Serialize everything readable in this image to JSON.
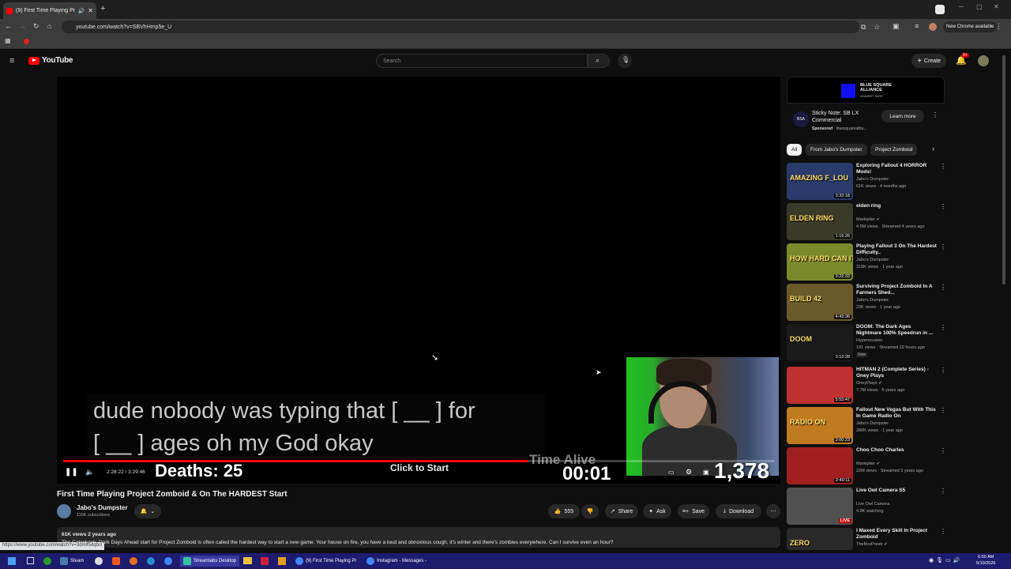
{
  "browser": {
    "tab_title": "(9) First Time Playing Proj",
    "new_tab_label": "+",
    "url": "youtube.com/watch?v=SBVhHmp5e_U",
    "new_chrome_label": "New Chrome available",
    "status_url": "https://www.youtube.com/watch?v=3dmlf5dqbcl"
  },
  "masthead": {
    "logo_text": "YouTube",
    "search_placeholder": "Search",
    "create_label": "Create",
    "notif_count": "9+"
  },
  "player": {
    "caption_line1": "dude nobody was typing that [ __ ] for",
    "caption_line2": "[ __ ] ages oh my God okay",
    "time_current": "2:28:22",
    "time_total": "3:29:46",
    "time_separator": " / ",
    "progress_fraction": 0.653,
    "overlay_deaths_label": "Deaths:",
    "overlay_deaths_value": "25",
    "overlay_click_to_start": "Click to Start",
    "overlay_time_alive_label": "Time Alive",
    "overlay_time_alive_value": "00:01",
    "overlay_score": "1,378"
  },
  "video": {
    "title": "First Time Playing Project Zomboid & On The HARDEST Start",
    "channel_name": "Jabo's Dumpster",
    "subscribers": "116K subscribers",
    "like_count": "555",
    "share_label": "Share",
    "ask_label": "Ask",
    "save_label": "Save",
    "download_label": "Download",
    "desc_meta": "61K views  2 years ago",
    "desc_text": "The Cataclysm: Dark Days Ahead start for Project Zomboid is often called the hardest way to start a new game. Your house on fire, you have a loud and obnoxious cough, it's winter and there's zombies everywhere. Can I survive even an hour?"
  },
  "ad": {
    "brand_title": "BLUE SQUARE ALLIANCE",
    "brand_sub": "AGAINST HATE",
    "title": "Sticky Note: SB LX Commercial",
    "sponsored": "Sponsored",
    "advertiser": "bluesquarealllia...",
    "learn_more": "Learn more",
    "logo_text": "BSA"
  },
  "chips": [
    "All",
    "From Jabo's Dumpster",
    "Project Zomboid"
  ],
  "recommendations": [
    {
      "title": "Exploring Fallout 4 HORROR Mods!",
      "channel": "Jabo's Dumpster",
      "meta": "61K views · 4 months ago",
      "duration": "3:33:18",
      "thumb_text": "AMAZING F_LOU",
      "thumb_color": "#2a3a6a",
      "verified": false
    },
    {
      "title": "elden ring",
      "channel": "Markiplier",
      "meta": "4.5M views · Streamed 4 years ago",
      "duration": "1:15:26",
      "thumb_text": "ELDEN RING",
      "thumb_color": "#3a3a2a",
      "verified": true
    },
    {
      "title": "Playing Fallout 3 On The Hardest Difficulty..",
      "channel": "Jabo's Dumpster",
      "meta": "318K views · 1 year ago",
      "duration": "3:22:33",
      "thumb_text": "HOW HARD CAN IT BE?",
      "thumb_color": "#7a8a2a",
      "verified": false
    },
    {
      "title": "Surviving Project Zomboid In A Farmers Shed...",
      "channel": "Jabo's Dumpster",
      "meta": "23K views · 1 year ago",
      "duration": "4:43:36",
      "thumb_text": "BUILD 42",
      "thumb_color": "#6a5a2a",
      "verified": false
    },
    {
      "title": "DOOM: The Dark Ages Nightmare 100% Speedrun in ...",
      "channel": "Hyperxcusion",
      "meta": "191 views · Streamed 10 hours ago",
      "duration": "3:13:28",
      "thumb_text": "DOOM",
      "thumb_color": "#1a1a1a",
      "verified": false,
      "badge": "New"
    },
    {
      "title": "HITMAN 2 (Complete Series) - Oney Plays",
      "channel": "OneyPlays",
      "meta": "7.7M views · 5 years ago",
      "duration": "5:53:47",
      "thumb_text": "",
      "thumb_color": "#c03030",
      "verified": true
    },
    {
      "title": "Fallout New Vegas But With This In Game Radio On",
      "channel": "Jabo's Dumpster",
      "meta": "280K views · 1 year ago",
      "duration": "3:00:23",
      "thumb_text": "RADIO ON",
      "thumb_color": "#c07a20",
      "verified": false
    },
    {
      "title": "Choo Choo Charles",
      "channel": "Markiplier",
      "meta": "22M views · Streamed 3 years ago",
      "duration": "2:49:11",
      "thumb_text": "",
      "thumb_color": "#a02020",
      "verified": true
    },
    {
      "title": "Live Owl Camera S5",
      "channel": "Live Owl Camera",
      "meta": "4.8K watching",
      "duration": "LIVE",
      "thumb_text": "",
      "thumb_color": "#505050",
      "verified": false,
      "live": true
    },
    {
      "title": "I Maxed Every Skill In Project Zomboid",
      "channel": "TheBoxPrestr",
      "meta": "",
      "duration": "",
      "thumb_text": "ZERO",
      "thumb_color": "#2a2a2a",
      "verified": true
    }
  ],
  "taskbar": {
    "items": [
      {
        "label": "Steam",
        "color": "#1b2838"
      },
      {
        "label": "Streamlabs Desktop",
        "color": "#31c3a2"
      },
      {
        "label": "(9) First Time Playing Pr",
        "color": "#4285f4"
      },
      {
        "label": "Instagram - Messages -",
        "color": "#4285f4"
      }
    ],
    "clock_time": "6:50 AM",
    "clock_date": "5/10/2026"
  },
  "colors": {
    "yt_red": "#ff0000",
    "taskbar_bg": "#1e1c6e",
    "page_bg": "#0f0f0f"
  }
}
